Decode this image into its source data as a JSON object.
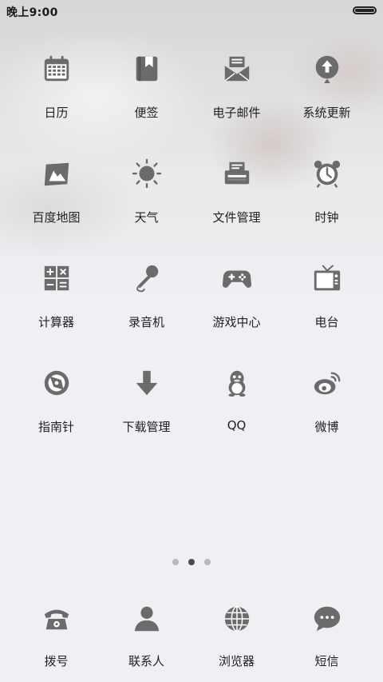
{
  "status_bar": {
    "time": "晚上9:00"
  },
  "apps": [
    [
      {
        "label": "日历",
        "icon": "calendar-icon"
      },
      {
        "label": "便签",
        "icon": "notes-icon"
      },
      {
        "label": "电子邮件",
        "icon": "email-icon"
      },
      {
        "label": "系统更新",
        "icon": "system-update-icon"
      }
    ],
    [
      {
        "label": "百度地图",
        "icon": "map-icon"
      },
      {
        "label": "天气",
        "icon": "sun-icon"
      },
      {
        "label": "文件管理",
        "icon": "file-manager-icon"
      },
      {
        "label": "时钟",
        "icon": "alarm-clock-icon"
      }
    ],
    [
      {
        "label": "计算器",
        "icon": "calculator-icon"
      },
      {
        "label": "录音机",
        "icon": "microphone-icon"
      },
      {
        "label": "游戏中心",
        "icon": "gamepad-icon"
      },
      {
        "label": "电台",
        "icon": "radio-tv-icon"
      }
    ],
    [
      {
        "label": "指南针",
        "icon": "compass-icon"
      },
      {
        "label": "下载管理",
        "icon": "download-arrow-icon"
      },
      {
        "label": "QQ",
        "icon": "qq-penguin-icon"
      },
      {
        "label": "微博",
        "icon": "weibo-eye-icon"
      }
    ]
  ],
  "page_indicator": {
    "pages": 3,
    "current": 2
  },
  "dock": [
    {
      "label": "拨号",
      "icon": "telephone-icon"
    },
    {
      "label": "联系人",
      "icon": "contact-person-icon"
    },
    {
      "label": "浏览器",
      "icon": "globe-icon"
    },
    {
      "label": "短信",
      "icon": "chat-bubble-icon"
    }
  ],
  "colors": {
    "icon": "#6b6b6b",
    "label": "#222222",
    "background": "#f0eff4"
  }
}
